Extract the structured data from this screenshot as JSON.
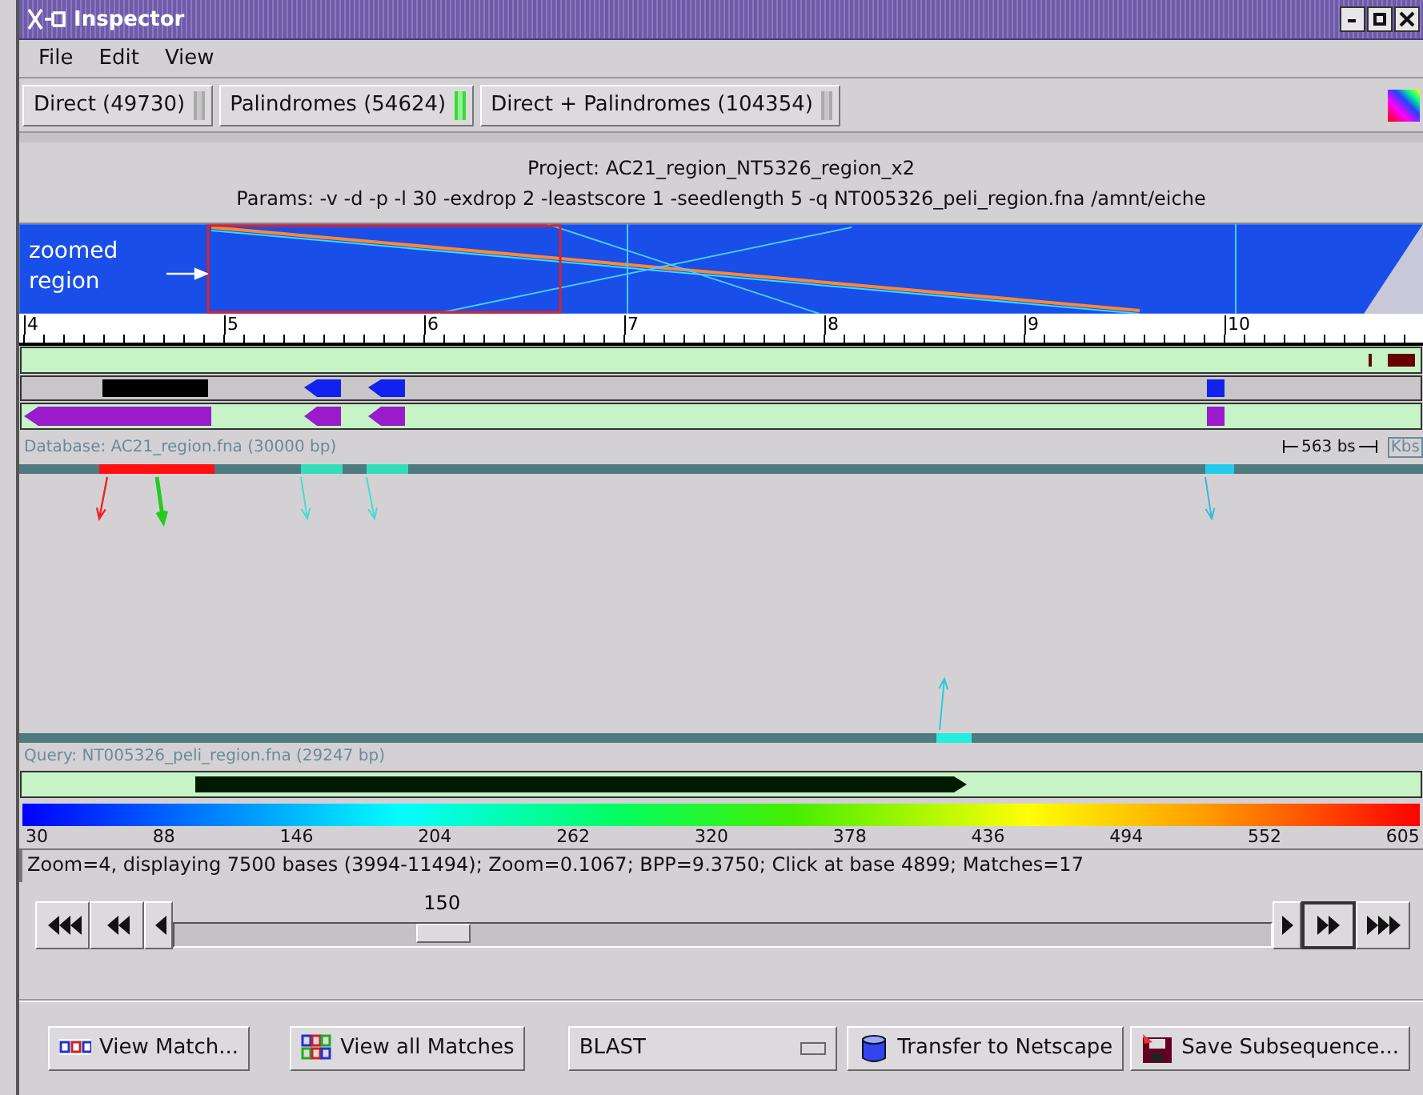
{
  "window": {
    "title": "Inspector"
  },
  "menu": [
    "File",
    "Edit",
    "View"
  ],
  "tabs": [
    {
      "label": "Direct (49730)",
      "selected": false
    },
    {
      "label": "Palindromes (54624)",
      "selected": true
    },
    {
      "label": "Direct + Palindromes (104354)",
      "selected": false
    }
  ],
  "project": {
    "title": "Project: AC21_region_NT5326_region_x2",
    "params": "Params: -v -d -p -l 30 -exdrop 2 -leastscore 1 -seedlength 5 -q NT005326_peli_region.fna /amnt/eiche"
  },
  "overview": {
    "label": "zoomed region"
  },
  "ruler": {
    "ticks": [
      "4",
      "5",
      "6",
      "7",
      "8",
      "9",
      "10"
    ]
  },
  "database": {
    "label": "Database: AC21_region.fna (30000 bp)",
    "scale": "563 bs",
    "unit": "Kbs"
  },
  "query": {
    "label": "Query: NT005326_peli_region.fna (29247 bp)"
  },
  "color_scale": [
    "30",
    "88",
    "146",
    "204",
    "262",
    "320",
    "378",
    "436",
    "494",
    "552",
    "605"
  ],
  "status": "Zoom=4, displaying 7500 bases (3994-11494); Zoom=0.1067; BPP=9.3750; Click at base 4899; Matches=17",
  "navigator": {
    "value": "150",
    "level": 0.22
  },
  "actions": [
    {
      "kind": "button",
      "label": "View Match..."
    },
    {
      "kind": "button",
      "label": "View all Matches"
    },
    {
      "kind": "dropdown",
      "label": "BLAST"
    },
    {
      "kind": "button",
      "label": "Transfer to Netscape"
    },
    {
      "kind": "button",
      "label": "Save Subsequence..."
    }
  ]
}
